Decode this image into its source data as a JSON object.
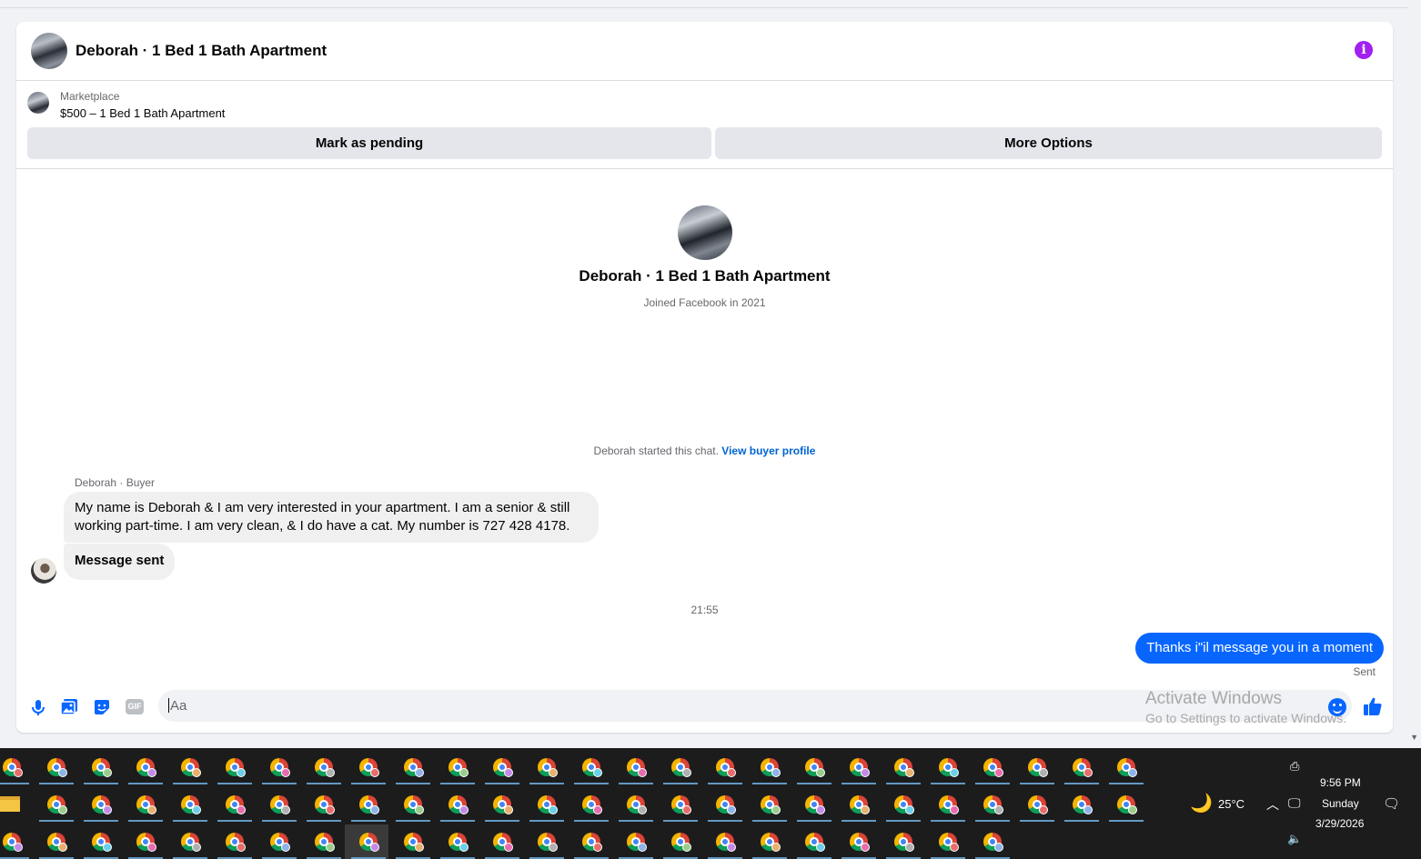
{
  "conversation": {
    "title": "Deborah · 1 Bed 1 Bath Apartment"
  },
  "listing": {
    "label": "Marketplace",
    "title": "$500 – 1 Bed 1 Bath Apartment",
    "mark_pending": "Mark as pending",
    "more_options": "More Options"
  },
  "profile": {
    "name": "Deborah · 1 Bed 1 Bath Apartment",
    "joined": "Joined Facebook in 2021"
  },
  "chat": {
    "started_text": "Deborah started this chat.",
    "view_profile": "View buyer profile",
    "sender_label": "Deborah · Buyer",
    "message_1": "My name is Deborah  & I am very interested in your apartment. I am a senior & still working part-time. I am very clean, & I do have a cat. My number is 727 428 4178.",
    "message_2": "Message sent",
    "timestamp": "21:55",
    "outgoing": "Thanks i\"il message you in a moment",
    "status": "Sent"
  },
  "composer": {
    "placeholder": "Aa",
    "icons": [
      "microphone-icon",
      "photo-icon",
      "sticker-icon",
      "gif-icon",
      "emoji-icon",
      "like-icon"
    ],
    "gif_label": "GIF"
  },
  "watermark": {
    "line1": "Activate Windows",
    "line2": "Go to Settings to activate Windows."
  },
  "taskbar": {
    "temperature": "25°C",
    "time": "9:56 PM",
    "day": "Sunday",
    "date": "3/29/2026"
  },
  "colors": {
    "accent": "#0866ff",
    "info": "#a020f0",
    "taskbar": "#1c1c1c"
  }
}
